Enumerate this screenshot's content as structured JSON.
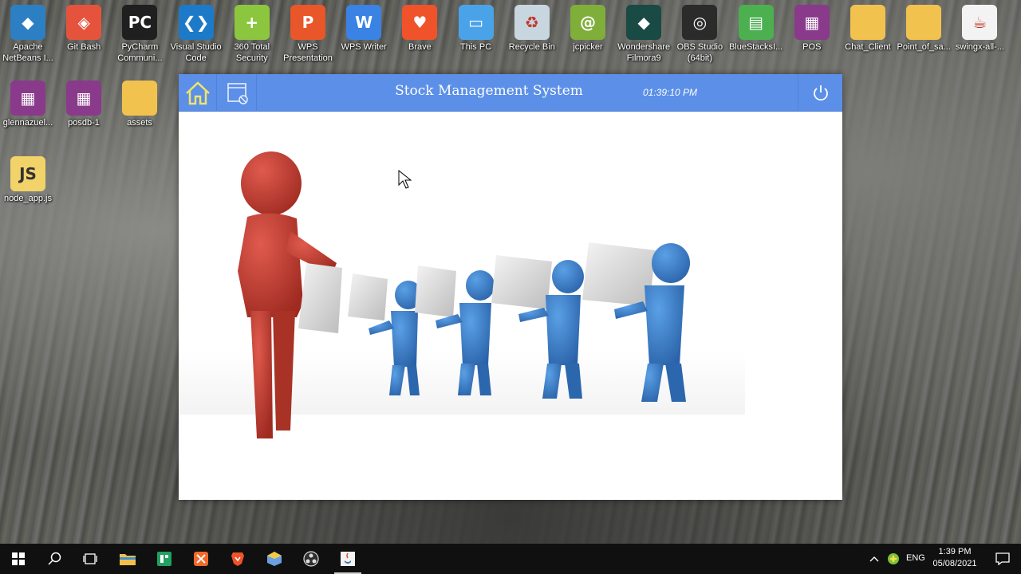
{
  "desktop": {
    "icons_row1": [
      {
        "label": "Apache\nNetBeans I...",
        "icon": "netbeans-icon"
      },
      {
        "label": "Git Bash",
        "icon": "git-bash-icon"
      },
      {
        "label": "PyCharm\nCommuni...",
        "icon": "pycharm-icon"
      },
      {
        "label": "Visual Studio\nCode",
        "icon": "vscode-icon"
      },
      {
        "label": "360 Total\nSecurity",
        "icon": "360-security-icon"
      },
      {
        "label": "WPS\nPresentation",
        "icon": "wps-presentation-icon"
      },
      {
        "label": "WPS Writer",
        "icon": "wps-writer-icon"
      },
      {
        "label": "Brave",
        "icon": "brave-icon"
      },
      {
        "label": "This PC",
        "icon": "this-pc-icon"
      },
      {
        "label": "Recycle Bin",
        "icon": "recycle-bin-icon"
      },
      {
        "label": "jcpicker",
        "icon": "jcpicker-icon"
      },
      {
        "label": "Wondershare\nFilmora9",
        "icon": "filmora-icon"
      },
      {
        "label": "OBS Studio\n(64bit)",
        "icon": "obs-icon"
      },
      {
        "label": "BlueStacksI...",
        "icon": "bluestacks-icon"
      },
      {
        "label": "POS",
        "icon": "rar-archive-icon"
      },
      {
        "label": "Chat_Client",
        "icon": "folder-icon"
      },
      {
        "label": "Point_of_sa...",
        "icon": "folder-icon"
      },
      {
        "label": "swingx-all-...",
        "icon": "java-jar-icon"
      }
    ],
    "icons_col1": [
      {
        "label": "glennazuel...",
        "icon": "rar-archive-icon"
      },
      {
        "label": "posdb-1",
        "icon": "rar-archive-icon"
      },
      {
        "label": "assets",
        "icon": "folder-icon"
      },
      {
        "label": "node_app.js",
        "icon": "js-file-icon"
      }
    ]
  },
  "app": {
    "title": "Stock Management System",
    "clock": "01:39:10 PM",
    "home_icon": "home-icon",
    "menu_icon": "window-settings-icon",
    "power_icon": "power-icon",
    "hero_image": "stock-delivery-illustration"
  },
  "taskbar": {
    "items": [
      "start-icon",
      "search-icon",
      "task-view-icon",
      "file-explorer-icon",
      "spreadsheet-icon",
      "netbeans-icon",
      "brave-icon",
      "virtualbox-icon",
      "obs-icon",
      "java-icon"
    ],
    "language": "ENG",
    "time": "1:39 PM",
    "date": "05/08/2021"
  },
  "colors": {
    "header_blue": "#5b8fe8",
    "figure_red": "#c0352b",
    "figure_blue": "#3a7cc8"
  }
}
